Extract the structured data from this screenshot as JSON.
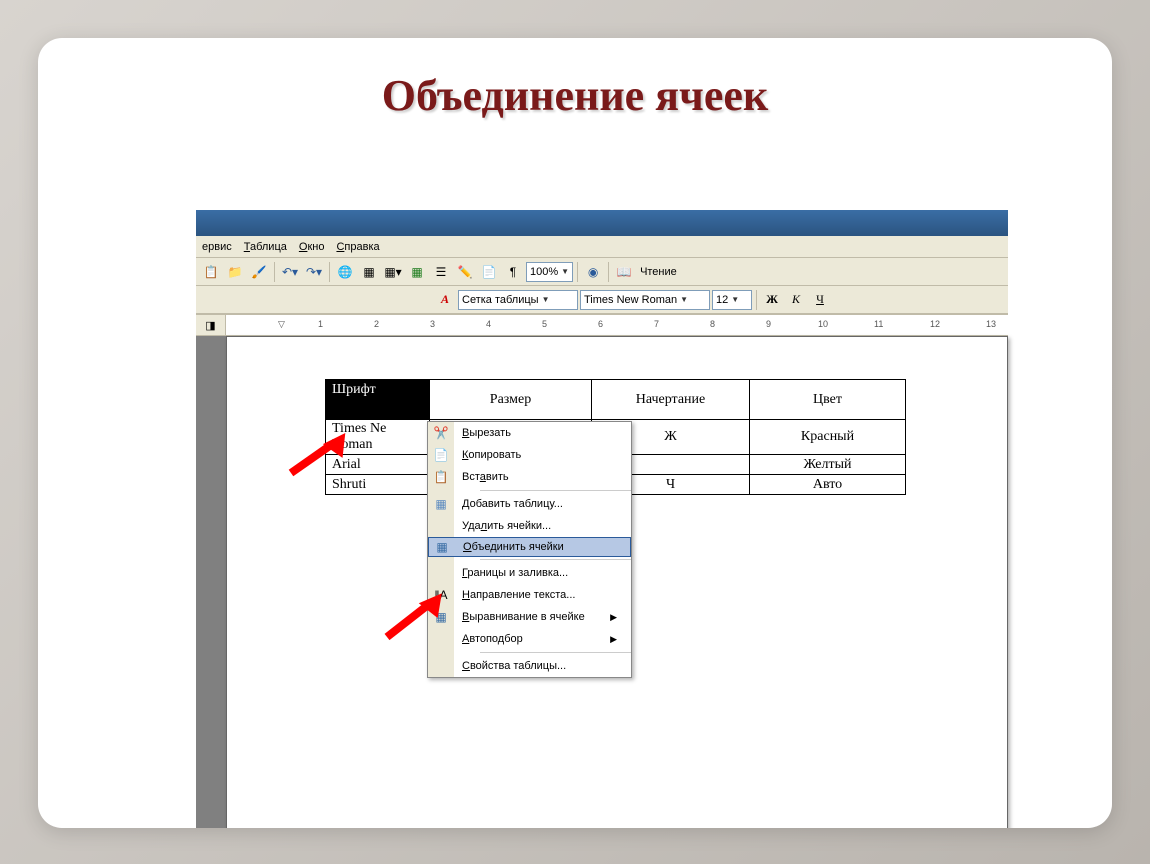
{
  "slide": {
    "title": "Объединение ячеек"
  },
  "menuBar": {
    "items": [
      "ервис",
      "Таблица",
      "Окно",
      "Справка"
    ]
  },
  "toolbar1": {
    "zoom": "100%",
    "reading": "Чтение"
  },
  "toolbar2": {
    "styleLabel": "Сетка таблицы",
    "fontLabel": "Times New Roman",
    "sizeLabel": "12",
    "bold": "Ж",
    "italic": "К",
    "underline": "Ч"
  },
  "table": {
    "col1Header": "Шрифт",
    "col2Header": "Размер",
    "col3Header": "Начертание",
    "col4Header": "Цвет",
    "rows": [
      {
        "font": "Times Ne",
        "font2": "Roman",
        "style": "Ж",
        "color": "Красный"
      },
      {
        "font": "Arial",
        "style": "",
        "color": "Желтый"
      },
      {
        "font": "Shruti",
        "style": "Ч",
        "color": "Авто"
      }
    ]
  },
  "contextMenu": {
    "cut": "Вырезать",
    "copy": "Копировать",
    "paste": "Вставить",
    "addTable": "Добавить таблицу...",
    "deleteCells": "Удалить ячейки...",
    "mergeCells": "Объединить ячейки",
    "borders": "Границы и заливка...",
    "textDirection": "Направление текста...",
    "alignment": "Выравнивание в ячейке",
    "autofit": "Автоподбор",
    "properties": "Свойства таблицы..."
  }
}
